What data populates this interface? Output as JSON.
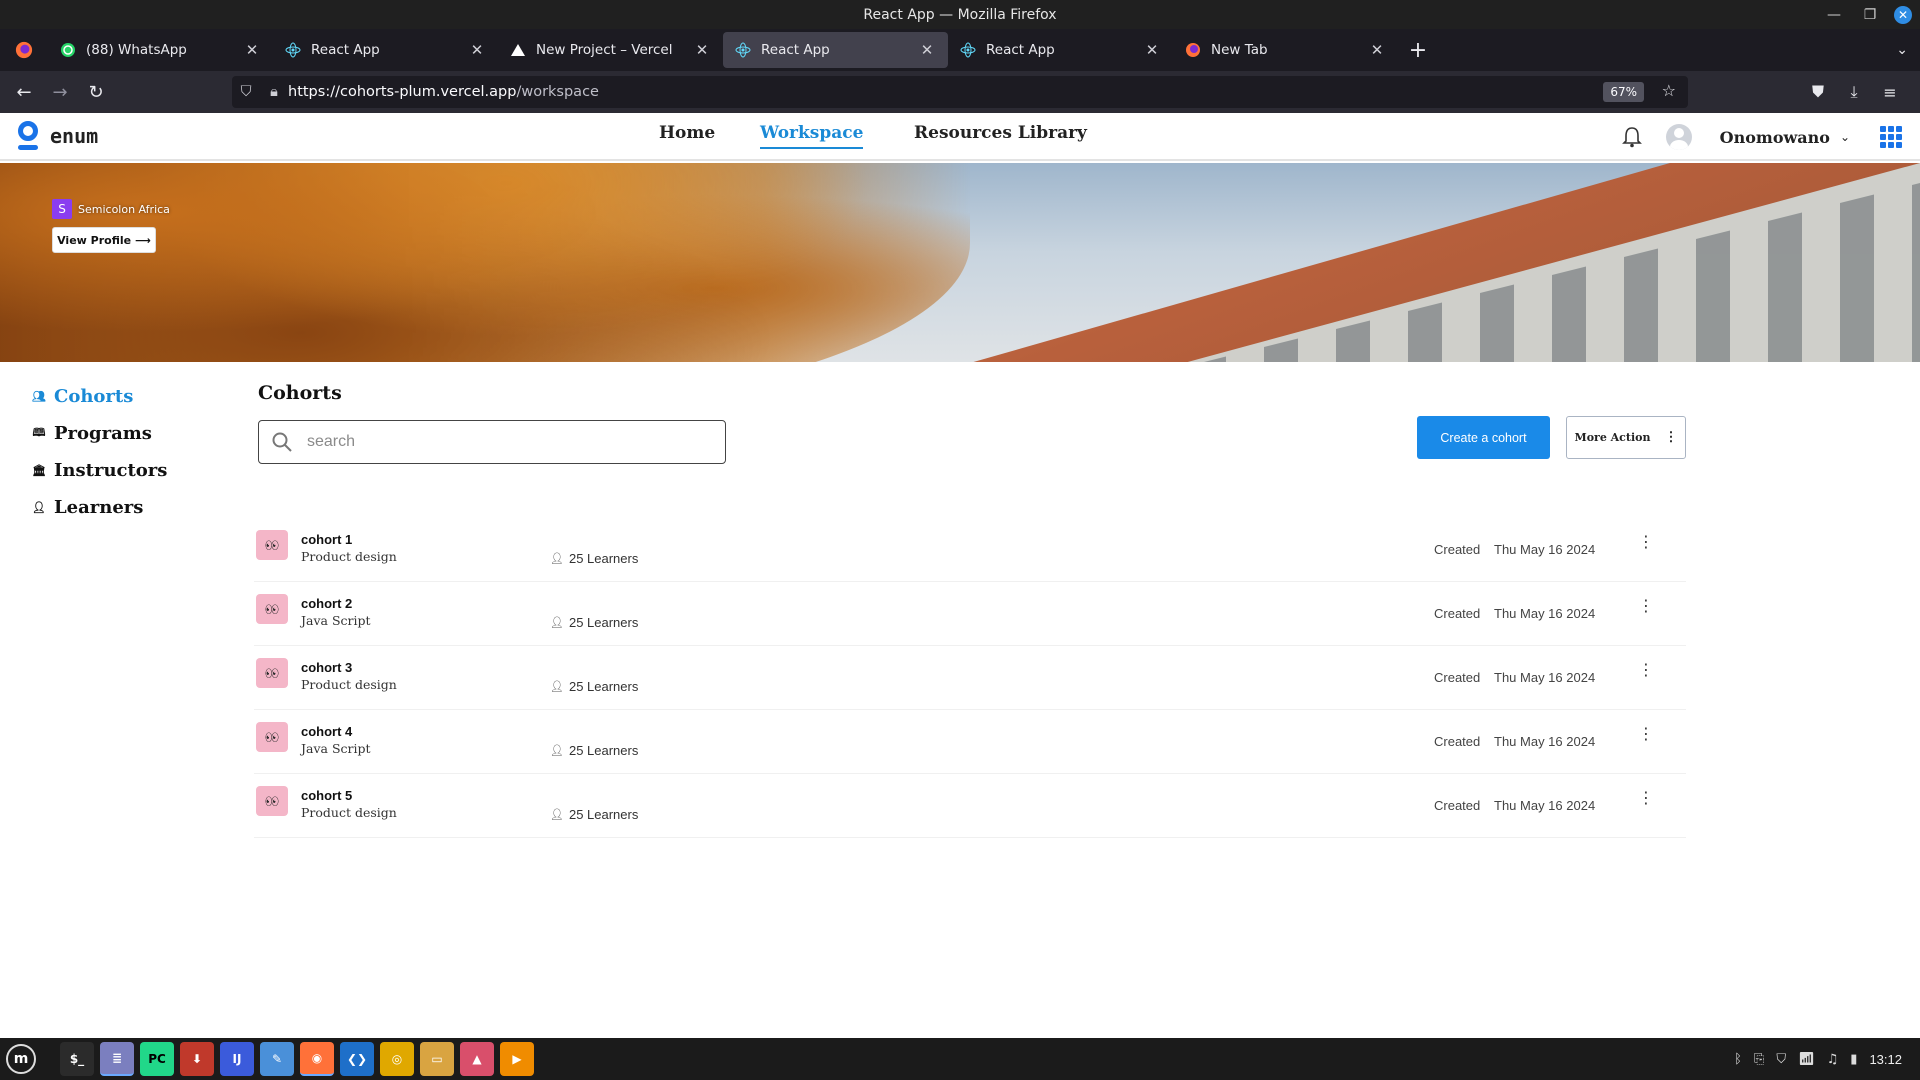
{
  "window": {
    "title": "React App — Mozilla Firefox"
  },
  "browser": {
    "tabs": [
      {
        "label": "(88) WhatsApp",
        "icon": "whatsapp-icon",
        "active": false
      },
      {
        "label": "React App",
        "icon": "react-icon",
        "active": false
      },
      {
        "label": "New Project – Vercel",
        "icon": "vercel-icon",
        "active": false
      },
      {
        "label": "React App",
        "icon": "react-icon",
        "active": true
      },
      {
        "label": "React App",
        "icon": "react-icon",
        "active": false
      },
      {
        "label": "New Tab",
        "icon": "firefox-icon",
        "active": false
      }
    ],
    "url_host": "https://cohorts-plum.vercel.app",
    "url_path": "/workspace",
    "zoom": "67%"
  },
  "app": {
    "brand": "enum",
    "nav": [
      {
        "label": "Home",
        "active": false
      },
      {
        "label": "Workspace",
        "active": true
      },
      {
        "label": "Resources Library",
        "active": false
      }
    ],
    "user": "Onomowano",
    "accent": "#1a8ad6"
  },
  "banner": {
    "org_initial": "S",
    "org_name": "Semicolon Africa",
    "view_profile": "View Profile"
  },
  "sidebar": {
    "items": [
      {
        "label": "Cohorts",
        "icon": "people-icon",
        "active": true
      },
      {
        "label": "Programs",
        "icon": "book-icon",
        "active": false
      },
      {
        "label": "Instructors",
        "icon": "building-icon",
        "active": false
      },
      {
        "label": "Learners",
        "icon": "person-icon",
        "active": false
      }
    ]
  },
  "main": {
    "title": "Cohorts",
    "search_placeholder": "search",
    "create_label": "Create a cohort",
    "more_label": "More Action",
    "created_label": "Created",
    "cohorts": [
      {
        "name": "cohort 1",
        "program": "Product design",
        "learners": "25 Learners",
        "date": "Thu May 16 2024"
      },
      {
        "name": "cohort 2",
        "program": "Java Script",
        "learners": "25 Learners",
        "date": "Thu May 16 2024"
      },
      {
        "name": "cohort 3",
        "program": "Product design",
        "learners": "25 Learners",
        "date": "Thu May 16 2024"
      },
      {
        "name": "cohort 4",
        "program": "Java Script",
        "learners": "25 Learners",
        "date": "Thu May 16 2024"
      },
      {
        "name": "cohort 5",
        "program": "Product design",
        "learners": "25 Learners",
        "date": "Thu May 16 2024"
      }
    ]
  },
  "taskbar": {
    "clock": "13:12",
    "apps": [
      "menu-icon",
      "terminal-icon",
      "text-editor-icon",
      "pycharm-icon",
      "downloader-icon",
      "intellij-icon",
      "notes-icon",
      "firefox-icon",
      "vscode-icon",
      "chrome-icon",
      "files-icon",
      "image-viewer-icon",
      "media-player-icon"
    ]
  }
}
